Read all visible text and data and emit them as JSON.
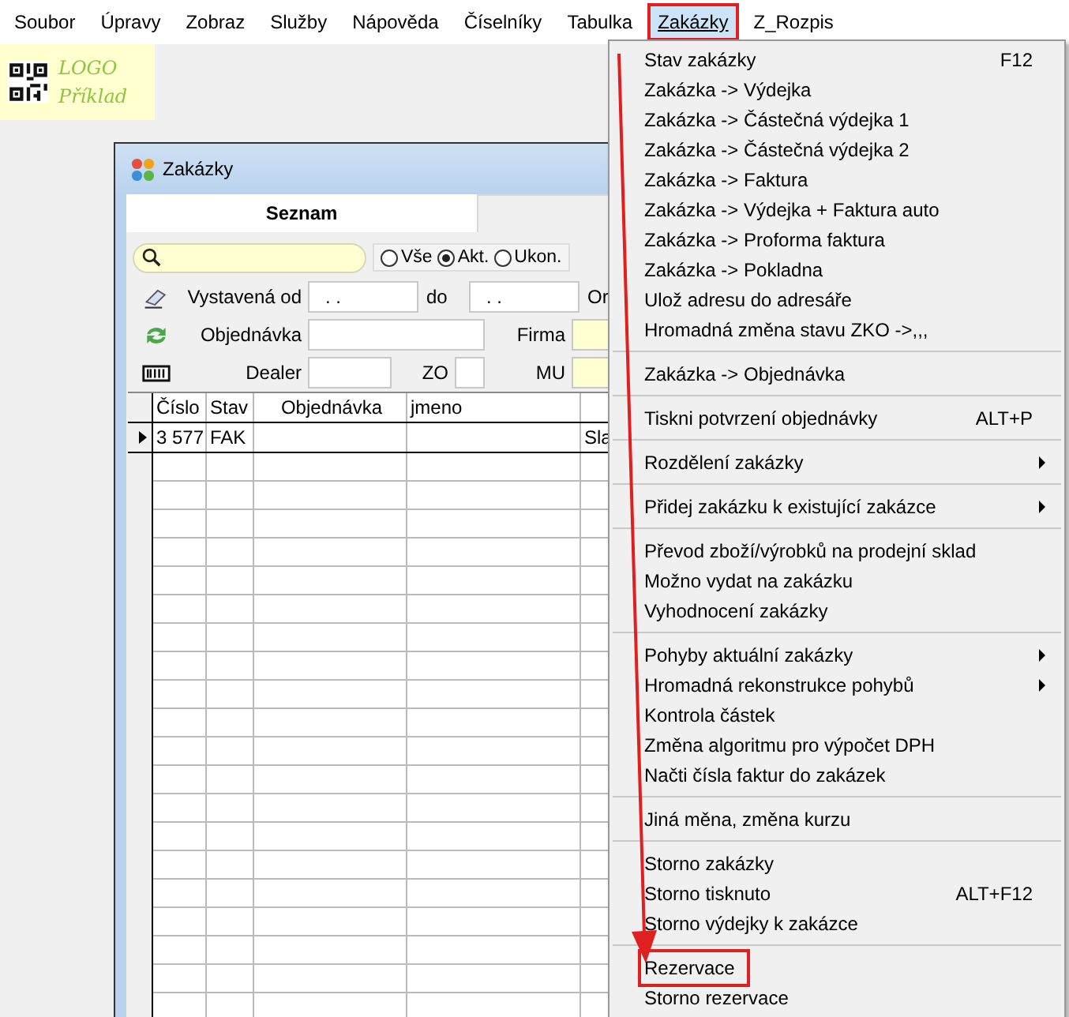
{
  "menubar": {
    "items": [
      {
        "label": "Soubor",
        "highlighted": false
      },
      {
        "label": "Úpravy",
        "highlighted": false
      },
      {
        "label": "Zobraz",
        "highlighted": false
      },
      {
        "label": "Služby",
        "highlighted": false
      },
      {
        "label": "Nápověda",
        "highlighted": false
      },
      {
        "label": "Číselníky",
        "highlighted": false
      },
      {
        "label": "Tabulka",
        "highlighted": false
      },
      {
        "label": "Zakázky",
        "highlighted": true
      },
      {
        "label": "Z_Rozpis",
        "highlighted": false
      }
    ]
  },
  "logo": {
    "line_1": "LOGO",
    "line_2": "Příklad"
  },
  "window": {
    "title": "Zakázky",
    "tabs": [
      {
        "label": "Seznam",
        "selected": true
      }
    ],
    "radios": [
      {
        "label": "Vše",
        "selected": false
      },
      {
        "label": "Akt.",
        "selected": true
      },
      {
        "label": "Ukon.",
        "selected": false
      }
    ],
    "filters": {
      "issued_from_label": "Vystavená od",
      "issued_from": ". .",
      "issued_to_label": "do",
      "issued_to": ". .",
      "cut_label": "Or",
      "order_label": "Objednávka",
      "company_label": "Firma",
      "dealer_label": "Dealer",
      "zo_label": "ZO",
      "mu_label": "MU"
    },
    "table": {
      "columns": [
        "Číslo",
        "Stav",
        "Objednávka",
        "jmeno",
        null
      ],
      "rows": [
        {
          "cells": [
            "3 577",
            "FAK",
            null,
            null,
            "Sla"
          ],
          "current": true
        }
      ]
    }
  },
  "menu": {
    "items": [
      {
        "kind": "item",
        "label": "Stav zakázky",
        "shortcut": "F12",
        "submenu": false,
        "highlighted": false
      },
      {
        "kind": "item",
        "label": "Zakázka -> Výdejka",
        "submenu": false,
        "highlighted": false
      },
      {
        "kind": "item",
        "label": "Zakázka -> Částečná výdejka 1",
        "submenu": false,
        "highlighted": false
      },
      {
        "kind": "item",
        "label": "Zakázka -> Částečná výdejka 2",
        "submenu": false,
        "highlighted": false
      },
      {
        "kind": "item",
        "label": "Zakázka -> Faktura",
        "submenu": false,
        "highlighted": false
      },
      {
        "kind": "item",
        "label": "Zakázka -> Výdejka + Faktura auto",
        "submenu": false,
        "highlighted": false
      },
      {
        "kind": "item",
        "label": "Zakázka -> Proforma faktura",
        "submenu": false,
        "highlighted": false
      },
      {
        "kind": "item",
        "label": "Zakázka -> Pokladna",
        "submenu": false,
        "highlighted": false
      },
      {
        "kind": "item",
        "label": "Ulož adresu do adresáře",
        "submenu": false,
        "highlighted": false
      },
      {
        "kind": "item",
        "label": "Hromadná změna stavu ZKO ->,,,",
        "submenu": false,
        "highlighted": false
      },
      {
        "kind": "separator"
      },
      {
        "kind": "item",
        "label": "Zakázka -> Objednávka",
        "submenu": false,
        "highlighted": false
      },
      {
        "kind": "separator"
      },
      {
        "kind": "item",
        "label": "Tiskni potvrzení objednávky",
        "shortcut": "ALT+P",
        "submenu": false,
        "highlighted": false
      },
      {
        "kind": "separator"
      },
      {
        "kind": "item",
        "label": "Rozdělení zakázky",
        "submenu": true,
        "highlighted": false
      },
      {
        "kind": "separator"
      },
      {
        "kind": "item",
        "label": "Přidej zakázku k existující zakázce",
        "submenu": true,
        "highlighted": false
      },
      {
        "kind": "separator"
      },
      {
        "kind": "item",
        "label": "Převod zboží/výrobků na prodejní sklad",
        "submenu": false,
        "highlighted": false
      },
      {
        "kind": "item",
        "label": "Možno vydat na zakázku",
        "submenu": false,
        "highlighted": false
      },
      {
        "kind": "item",
        "label": "Vyhodnocení zakázky",
        "submenu": false,
        "highlighted": false
      },
      {
        "kind": "separator"
      },
      {
        "kind": "item",
        "label": "Pohyby aktuální zakázky",
        "submenu": true,
        "highlighted": false
      },
      {
        "kind": "item",
        "label": "Hromadná rekonstrukce pohybů",
        "submenu": true,
        "highlighted": false
      },
      {
        "kind": "item",
        "label": "Kontrola částek",
        "submenu": false,
        "highlighted": false
      },
      {
        "kind": "item",
        "label": "Změna algoritmu pro výpočet DPH",
        "submenu": false,
        "highlighted": false
      },
      {
        "kind": "item",
        "label": "Načti čísla faktur do zakázek",
        "submenu": false,
        "highlighted": false
      },
      {
        "kind": "separator"
      },
      {
        "kind": "item",
        "label": "Jiná měna, změna kurzu",
        "submenu": false,
        "highlighted": false
      },
      {
        "kind": "separator"
      },
      {
        "kind": "item",
        "label": "Storno zakázky",
        "submenu": false,
        "highlighted": false
      },
      {
        "kind": "item",
        "label": "Storno tisknuto",
        "shortcut": "ALT+F12",
        "submenu": false,
        "highlighted": false
      },
      {
        "kind": "item",
        "label": "Storno výdejky k zakázce",
        "submenu": false,
        "highlighted": false
      },
      {
        "kind": "separator"
      },
      {
        "kind": "item",
        "label": "Rezervace",
        "submenu": false,
        "highlighted": true
      },
      {
        "kind": "item",
        "label": "Storno rezervace",
        "submenu": false,
        "highlighted": false
      }
    ]
  }
}
